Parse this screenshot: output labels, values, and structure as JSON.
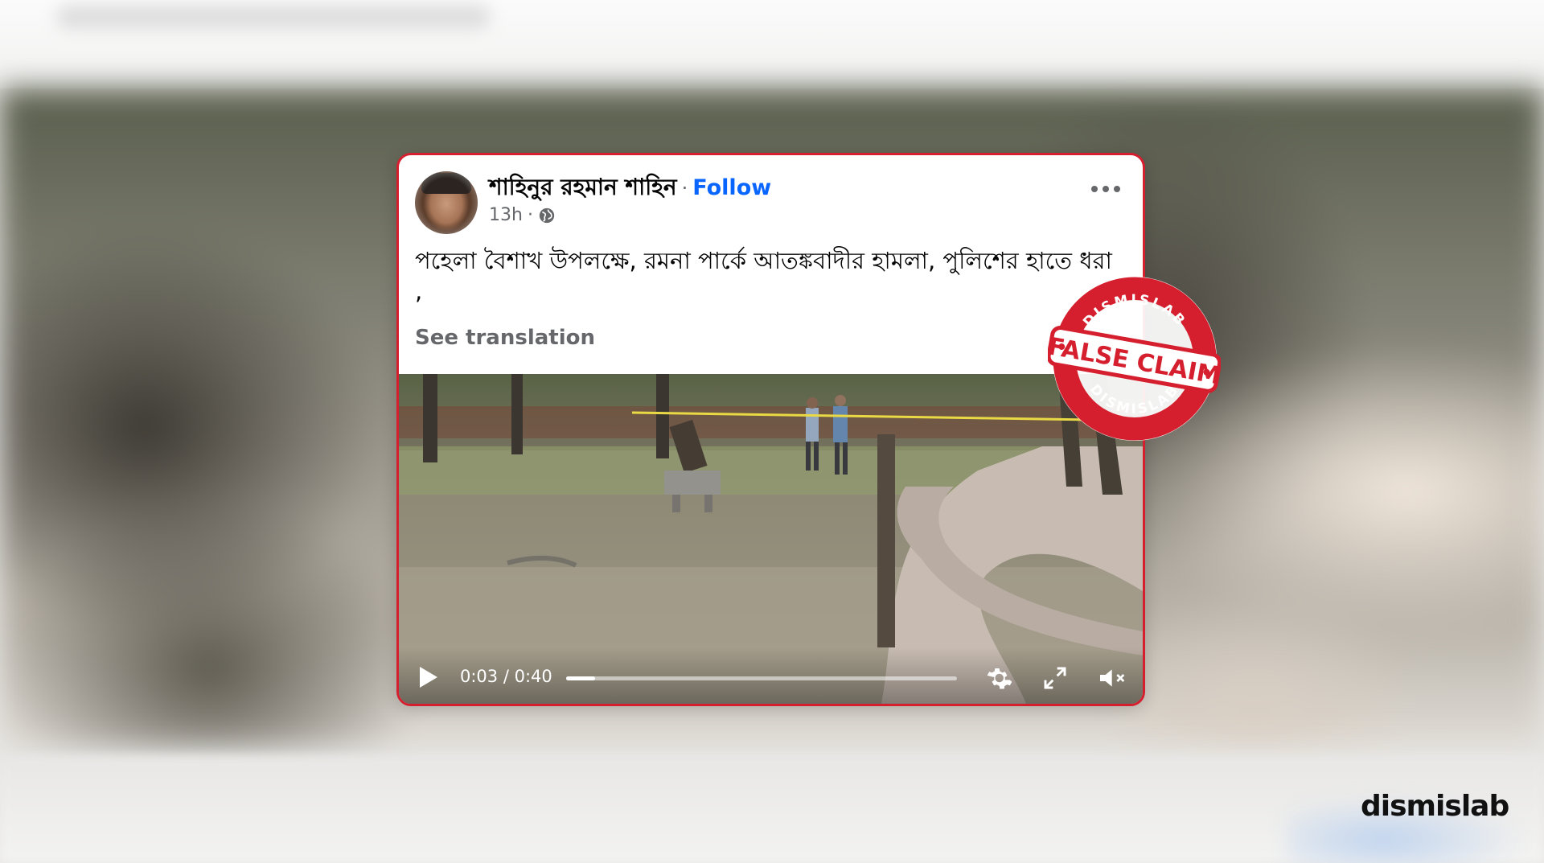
{
  "post": {
    "author_name": "শাহিনুর রহমান শাহিন",
    "separator": "·",
    "follow_label": "Follow",
    "timestamp": "13h",
    "meta_separator": "·",
    "audience_icon": "globe-icon",
    "more_icon": "more-horizontal-icon",
    "text": "পহেলা বৈশাখ উপলক্ষে, রমনা পার্কে আতঙ্কবাদীর হামলা, পুলিশের হাতে ধরা ,",
    "see_translation_label": "See translation"
  },
  "video": {
    "current_time": "0:03",
    "time_separator": " / ",
    "duration": "0:40",
    "progress_fraction": 0.075,
    "icons": [
      "play-icon",
      "gear-icon",
      "fullscreen-icon",
      "mute-icon"
    ]
  },
  "stamp": {
    "top_text": "DISMISLAB",
    "main_text": "FALSE CLAIM",
    "bottom_text": "DISMISLAB",
    "color": "#d61f2e"
  },
  "brand": {
    "logo_text": "dismislab"
  },
  "colors": {
    "accent_border": "#d61f2e",
    "follow_link": "#0866ff",
    "secondary_text": "#65676b"
  }
}
